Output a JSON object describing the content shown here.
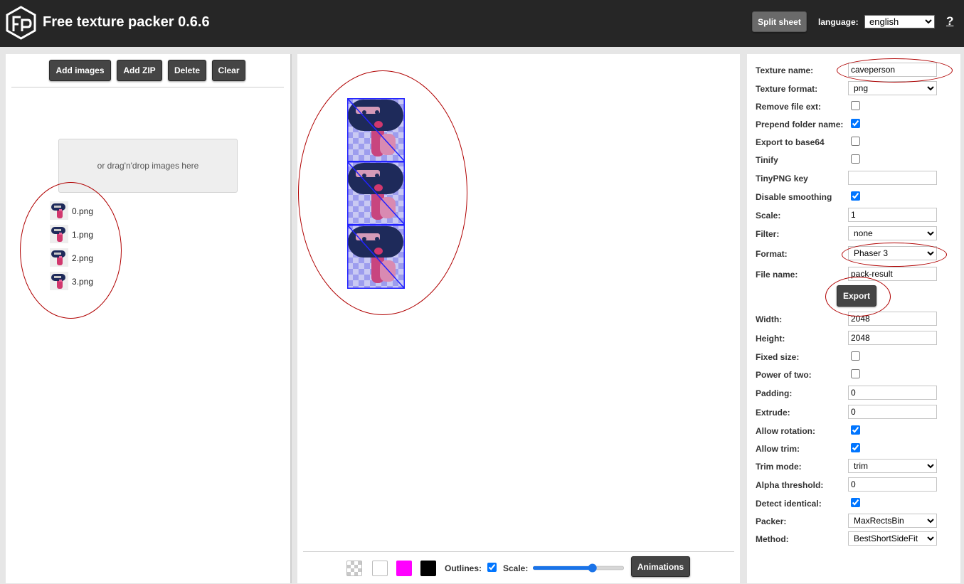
{
  "header": {
    "title": "Free texture packer 0.6.6",
    "split_sheet_label": "Split sheet",
    "language_label": "language:",
    "language_value": "english",
    "help_label": "?"
  },
  "left": {
    "add_images": "Add images",
    "add_zip": "Add ZIP",
    "delete": "Delete",
    "clear": "Clear",
    "dropzone_text": "or drag'n'drop images here",
    "files": [
      "0.png",
      "1.png",
      "2.png",
      "3.png"
    ]
  },
  "bottom": {
    "outlines_label": "Outlines:",
    "scale_label": "Scale:",
    "animations_label": "Animations",
    "swatch_colors": [
      "checker",
      "#ffffff",
      "#ff00ff",
      "#000000"
    ],
    "scale_value_percent": 67
  },
  "settings": {
    "texture_name_label": "Texture name:",
    "texture_name_value": "caveperson",
    "texture_format_label": "Texture format:",
    "texture_format_value": "png",
    "remove_file_ext_label": "Remove file ext:",
    "prepend_folder_label": "Prepend folder name:",
    "export_base64_label": "Export to base64",
    "tinify_label": "Tinify",
    "tinypng_key_label": "TinyPNG key",
    "tinypng_key_value": "",
    "disable_smoothing_label": "Disable smoothing",
    "scale_label": "Scale:",
    "scale_value": "1",
    "filter_label": "Filter:",
    "filter_value": "none",
    "format_label": "Format:",
    "format_value": "Phaser 3",
    "file_name_label": "File name:",
    "file_name_value": "pack-result",
    "export_label": "Export",
    "width_label": "Width:",
    "width_value": "2048",
    "height_label": "Height:",
    "height_value": "2048",
    "fixed_size_label": "Fixed size:",
    "power_of_two_label": "Power of two:",
    "padding_label": "Padding:",
    "padding_value": "0",
    "extrude_label": "Extrude:",
    "extrude_value": "0",
    "allow_rotation_label": "Allow rotation:",
    "allow_trim_label": "Allow trim:",
    "trim_mode_label": "Trim mode:",
    "trim_mode_value": "trim",
    "alpha_threshold_label": "Alpha threshold:",
    "alpha_threshold_value": "0",
    "detect_identical_label": "Detect identical:",
    "packer_label": "Packer:",
    "packer_value": "MaxRectsBin",
    "method_label": "Method:",
    "method_value": "BestShortSideFit"
  },
  "colors": {
    "topbar": "#262626",
    "button": "#454545",
    "annotation": "#b00000",
    "sprite_outline": "#2222ff"
  }
}
